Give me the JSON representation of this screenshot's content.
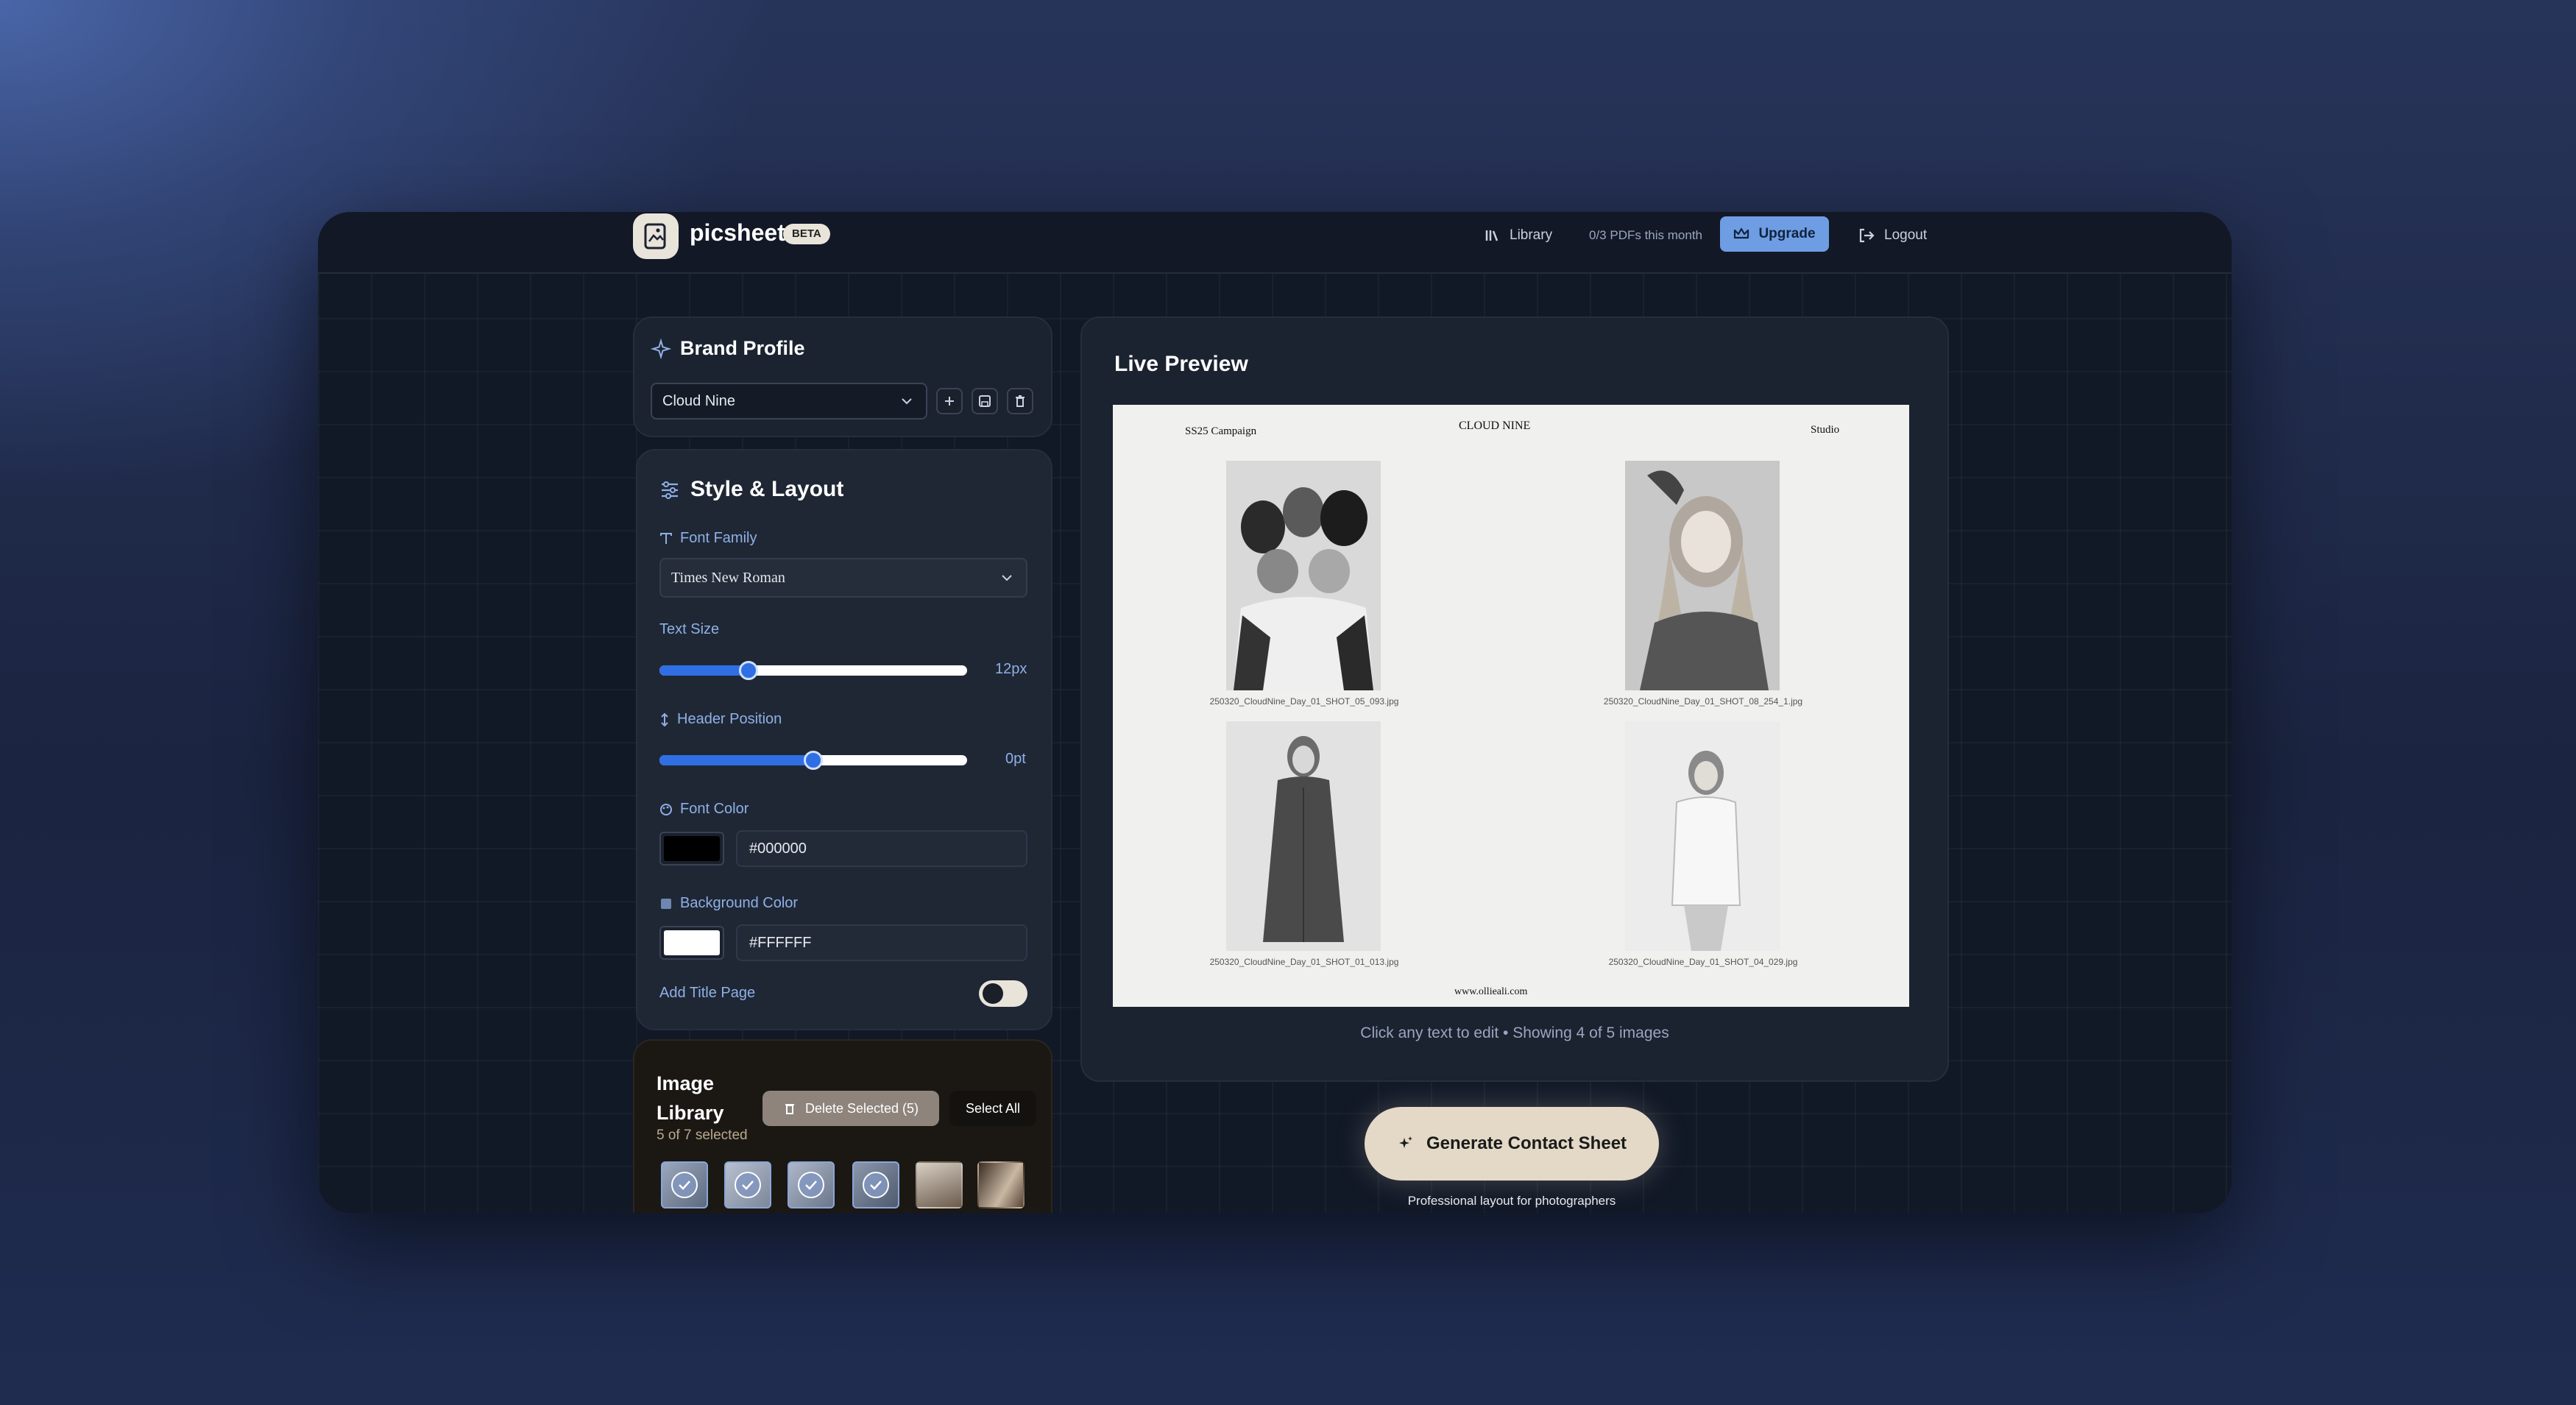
{
  "app": {
    "name": "picsheet",
    "badge": "BETA"
  },
  "nav": {
    "library": "Library",
    "usage": "0/3 PDFs this month",
    "upgrade": "Upgrade",
    "logout": "Logout"
  },
  "brand_profile": {
    "title": "Brand Profile",
    "selected": "Cloud Nine"
  },
  "style_layout": {
    "title": "Style & Layout",
    "font_family_label": "Font Family",
    "font_family_value": "Times New Roman",
    "text_size_label": "Text Size",
    "text_size_value": "12px",
    "text_size_fraction": 0.29,
    "header_position_label": "Header Position",
    "header_position_value": "0pt",
    "header_position_fraction": 0.5,
    "font_color_label": "Font Color",
    "font_color_hex": "#000000",
    "background_color_label": "Background Color",
    "background_color_hex": "#FFFFFF",
    "add_title_page_label": "Add Title Page"
  },
  "image_library": {
    "title_line1": "Image",
    "title_line2": "Library",
    "selected_count": "5 of 7 selected",
    "delete_label": "Delete Selected (5)",
    "select_all_label": "Select All"
  },
  "preview": {
    "title": "Live Preview",
    "sheet_left_header": "SS25 Campaign",
    "sheet_center_header": "CLOUD NINE",
    "sheet_right_header": "Studio",
    "sheet_footer": "www.ollieali.com",
    "images": [
      "250320_CloudNine_Day_01_SHOT_05_093.jpg",
      "250320_CloudNine_Day_01_SHOT_08_254_1.jpg",
      "250320_CloudNine_Day_01_SHOT_01_013.jpg",
      "250320_CloudNine_Day_01_SHOT_04_029.jpg"
    ],
    "hint": "Click any text to edit • Showing 4 of 5 images"
  },
  "generate": {
    "label": "Generate Contact Sheet",
    "sub": "Professional layout for photographers"
  },
  "colors": {
    "accent": "#2f6fe3",
    "upgrade_bg": "#6f9de3",
    "cta_bg": "#e3d9c6"
  }
}
